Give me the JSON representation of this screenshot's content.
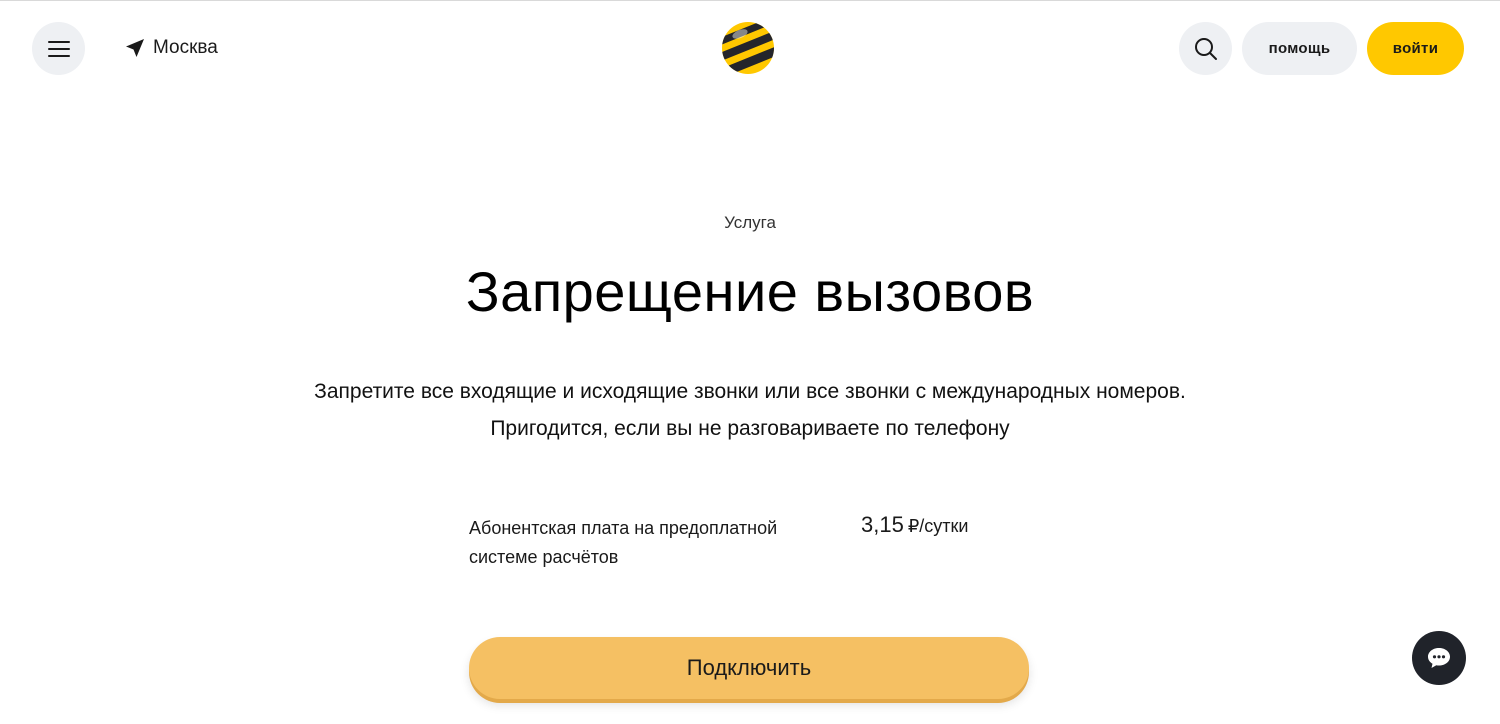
{
  "header": {
    "menu_icon": "hamburger-icon",
    "city": "Москва",
    "city_icon": "location-arrow-icon",
    "logo": "beeline-logo",
    "search_icon": "search-icon",
    "help_label": "помощь",
    "login_label": "войти"
  },
  "main": {
    "eyebrow": "Услуга",
    "title": "Запрещение вызовов",
    "description": "Запретите все входящие и исходящие звонки или все звонки с международных номеров. Пригодится, если вы не разговариваете по телефону",
    "fee_label": "Абонентская плата на предоплатной системе расчётов",
    "fee_amount": "3,15",
    "fee_unit": "₽/сутки",
    "connect_label": "Подключить"
  },
  "chat": {
    "icon": "chat-bubble-icon"
  },
  "colors": {
    "accent_yellow": "#ffc800",
    "button_orange": "#f5c063",
    "light_gray": "#eef0f3",
    "dark": "#20232a"
  }
}
